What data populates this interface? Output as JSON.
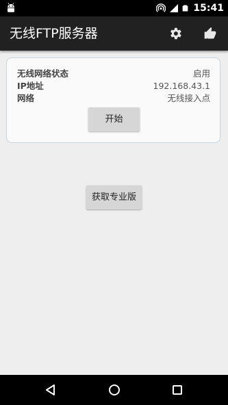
{
  "status_bar": {
    "time": "15:41",
    "icons": [
      "android-debug-icon",
      "hotspot-icon",
      "signal-icon",
      "battery-icon"
    ]
  },
  "app_bar": {
    "title": "无线FTP服务器",
    "actions": [
      "settings-icon",
      "thumbs-up-icon"
    ]
  },
  "card": {
    "rows": [
      {
        "label": "无线网络状态",
        "value": "启用"
      },
      {
        "label": "IP地址",
        "value": "192.168.43.1"
      },
      {
        "label": "网络",
        "value": "无线接入点"
      }
    ],
    "start_button": "开始"
  },
  "pro_button": "获取专业版",
  "nav_bar": {
    "buttons": [
      "back-icon",
      "home-icon",
      "recent-apps-icon"
    ]
  },
  "colors": {
    "app_bar": "#212121",
    "background": "#eeeeee",
    "button": "#d6d6d6",
    "card_border": "#c9d3dc"
  }
}
